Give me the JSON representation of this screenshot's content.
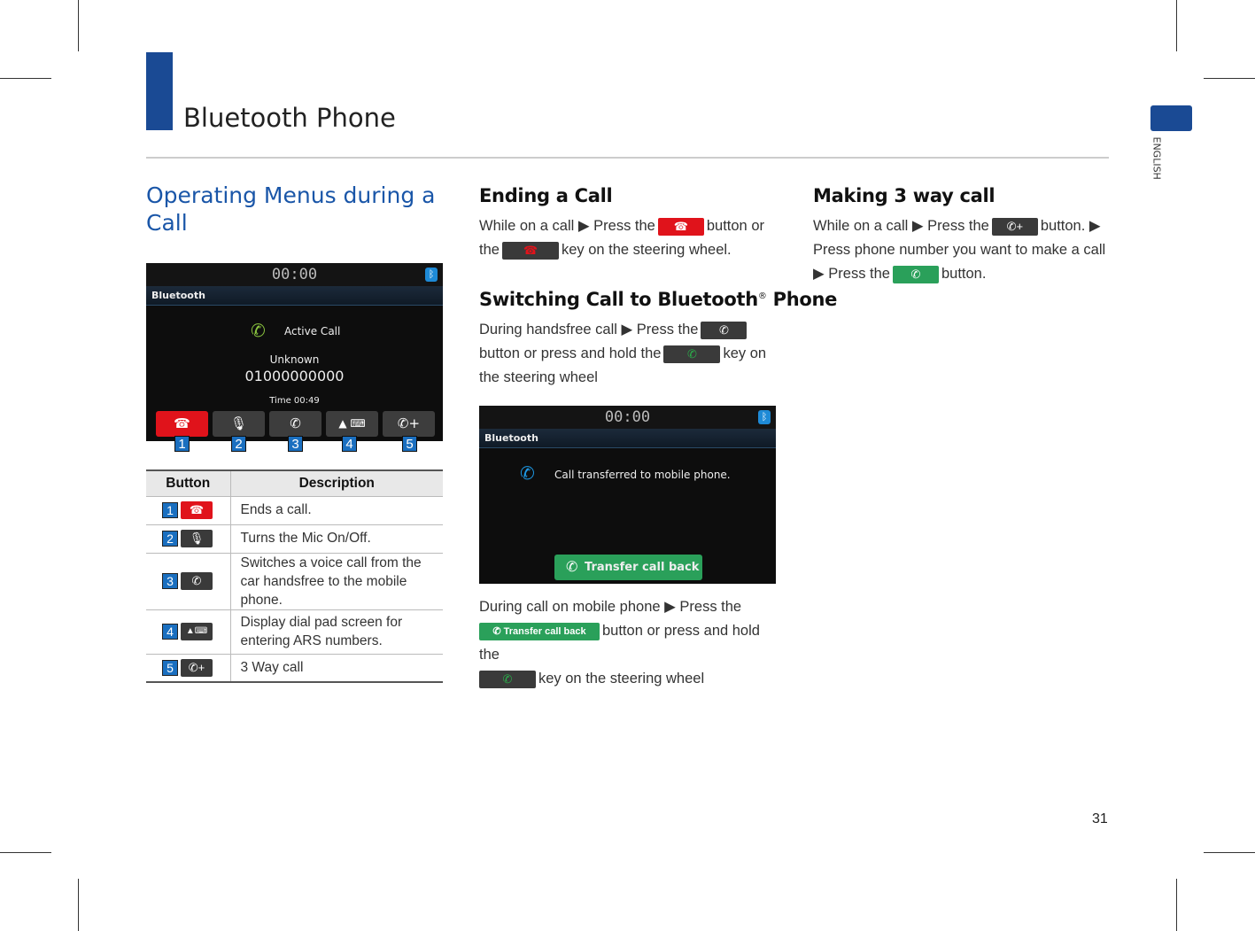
{
  "header": {
    "title": "Bluetooth Phone",
    "side_tab": "ENGLISH",
    "page_number": "31",
    "accent_color": "#1a4a94"
  },
  "col1": {
    "heading": "Operating Menus during a Call",
    "screen": {
      "clock": "00:00",
      "bar": "Bluetooth",
      "status": "Active Call",
      "name": "Unknown",
      "number": "01000000000",
      "time": "Time 00:49",
      "callouts": [
        "1",
        "2",
        "3",
        "4",
        "5"
      ]
    },
    "table": {
      "headers": [
        "Button",
        "Description"
      ],
      "rows": [
        {
          "num": "1",
          "icon": "end-call-icon",
          "desc": "Ends a call."
        },
        {
          "num": "2",
          "icon": "mic-off-icon",
          "desc": "Turns the Mic On/Off."
        },
        {
          "num": "3",
          "icon": "transfer-call-icon",
          "desc": "Switches a voice call from the car handsfree to the mobile phone."
        },
        {
          "num": "4",
          "icon": "dial-pad-icon",
          "desc": "Display dial pad screen for entering ARS numbers."
        },
        {
          "num": "5",
          "icon": "add-call-icon",
          "desc": "3 Way call"
        }
      ]
    }
  },
  "col2": {
    "ending": {
      "heading": "Ending a Call",
      "t1": "While on a call ▶ Press the",
      "t2": "button or the",
      "t3": "key on the steering wheel."
    },
    "switching": {
      "heading": "Switching Call to Bluetooth",
      "reg": "®",
      "heading_end": " Phone",
      "t1": "During handsfree call ▶ Press the",
      "t2": "button or press and hold the",
      "t3": "key on the steering wheel"
    },
    "screen": {
      "clock": "00:00",
      "bar": "Bluetooth",
      "message": "Call transferred to mobile phone.",
      "button": "Transfer call back"
    },
    "after": {
      "t1": "During call on mobile phone ▶ Press the",
      "button": "Transfer call back",
      "t2": "button or press and hold the",
      "t3": "key on the steering wheel"
    }
  },
  "col3": {
    "heading": "Making 3 way call",
    "t1": "While on a call ▶ Press the",
    "t2": "button. ▶ Press phone number you want to make a call ▶ Press the",
    "t3": "button."
  }
}
